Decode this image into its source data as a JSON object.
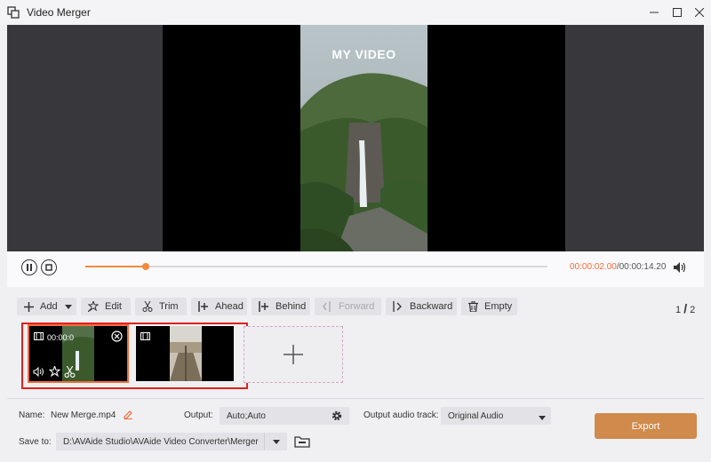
{
  "window": {
    "title": "Video Merger"
  },
  "preview": {
    "overlay_text": "MY VIDEO"
  },
  "player": {
    "current_time": "00:00:02.00",
    "total_time": "/00:00:14.20",
    "progress_fraction": 0.13
  },
  "toolbar": {
    "add": "Add",
    "edit": "Edit",
    "trim": "Trim",
    "ahead": "Ahead",
    "behind": "Behind",
    "forward": "Forward",
    "backward": "Backward",
    "empty": "Empty",
    "page_current": "1",
    "page_sep": "/",
    "page_total": "2"
  },
  "clips": [
    {
      "duration": "00:00:0",
      "selected": true
    },
    {
      "duration": "",
      "selected": false
    }
  ],
  "bottom": {
    "name_label": "Name:",
    "name_value": "New Merge.mp4",
    "output_label": "Output:",
    "output_value": "Auto;Auto",
    "audio_label": "Output audio track:",
    "audio_value": "Original Audio",
    "save_label": "Save to:",
    "save_path": "D:\\AVAide Studio\\AVAide Video Converter\\Merger",
    "export_label": "Export"
  },
  "colors": {
    "accent": "#f26b3a",
    "export": "#d08a4c",
    "selection_border": "#e02020"
  }
}
